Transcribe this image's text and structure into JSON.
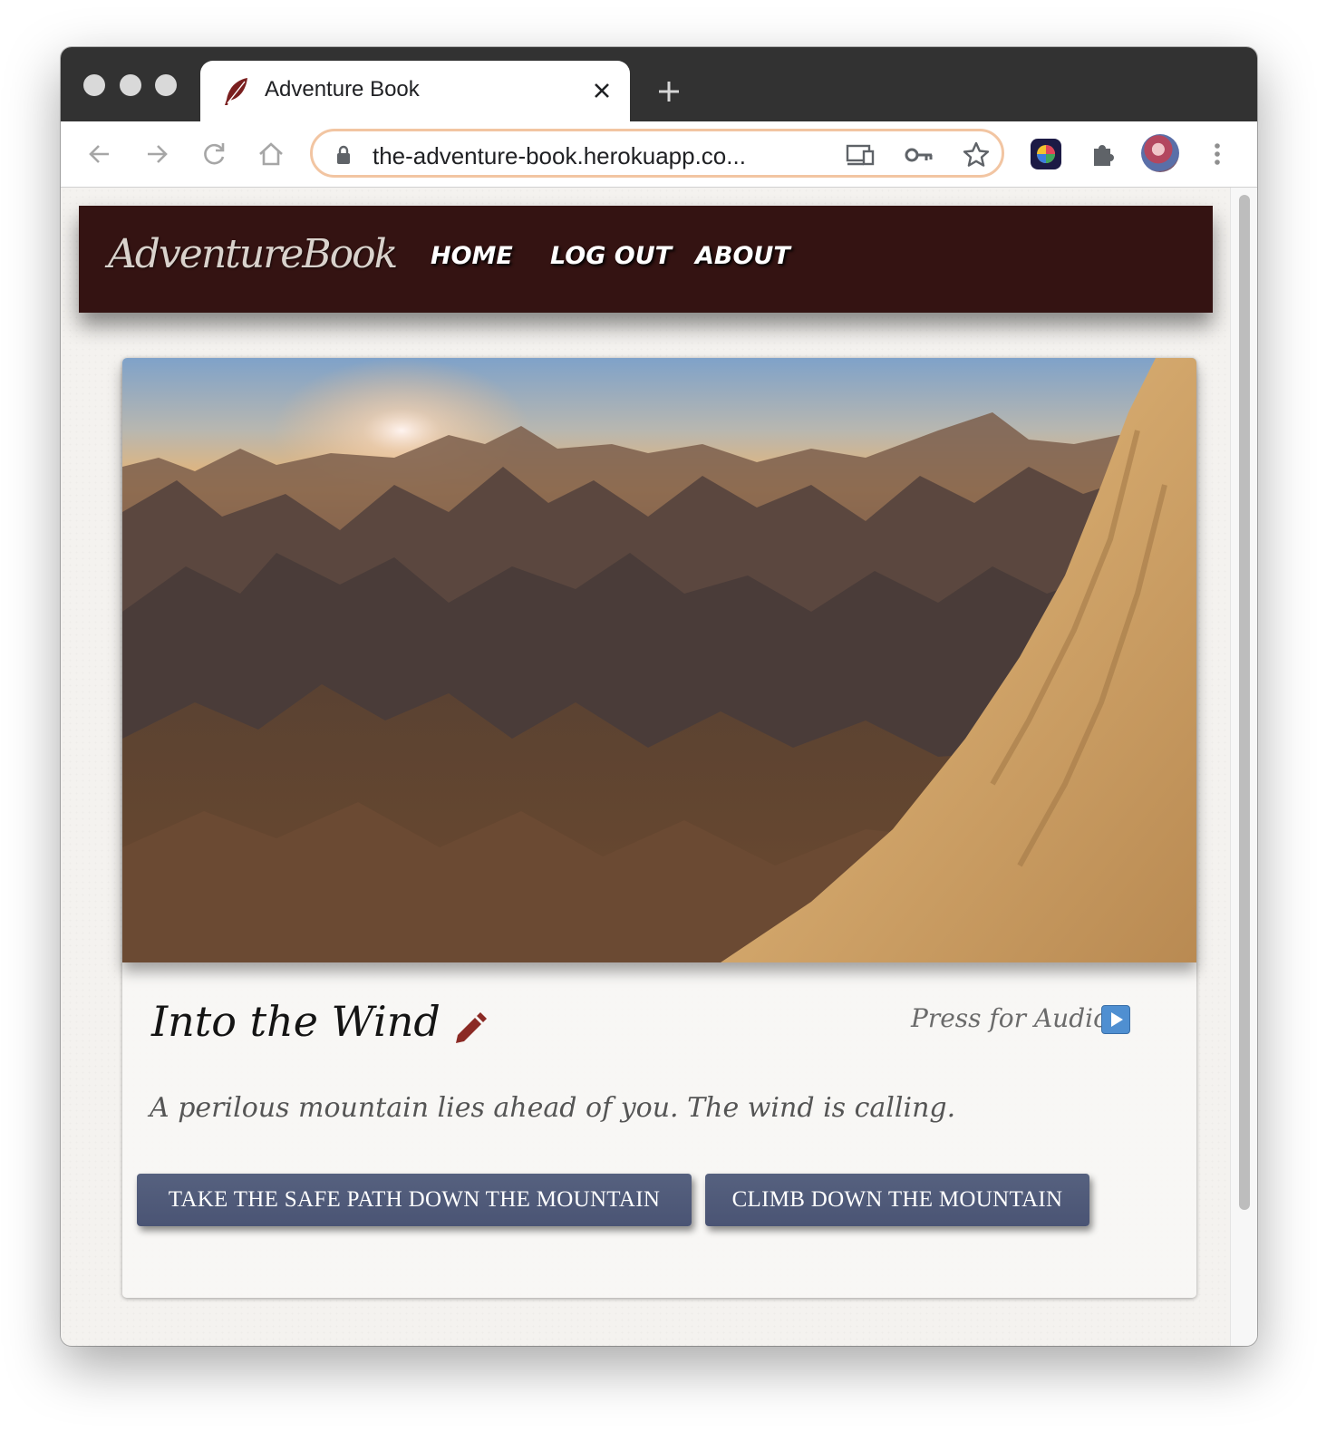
{
  "browser": {
    "tab_title": "Adventure Book",
    "url": "the-adventure-book.herokuapp.co..."
  },
  "site": {
    "brand": "AdventureBook",
    "nav": [
      "HOME",
      "LOG OUT",
      "ABOUT"
    ]
  },
  "story": {
    "title": "Into the Wind",
    "audio_label": "Press for Audio",
    "description": "A perilous mountain lies ahead of you. The wind is calling.",
    "choices": [
      "TAKE THE SAFE PATH DOWN THE MOUNTAIN",
      "CLIMB DOWN THE MOUNTAIN"
    ]
  },
  "colors": {
    "navbar": "#341312",
    "button": "#4f5a79",
    "edit_icon": "#8b2a25"
  },
  "icons": {
    "tab": "feather-icon",
    "edit": "pencil-icon",
    "audio": "play-icon"
  }
}
